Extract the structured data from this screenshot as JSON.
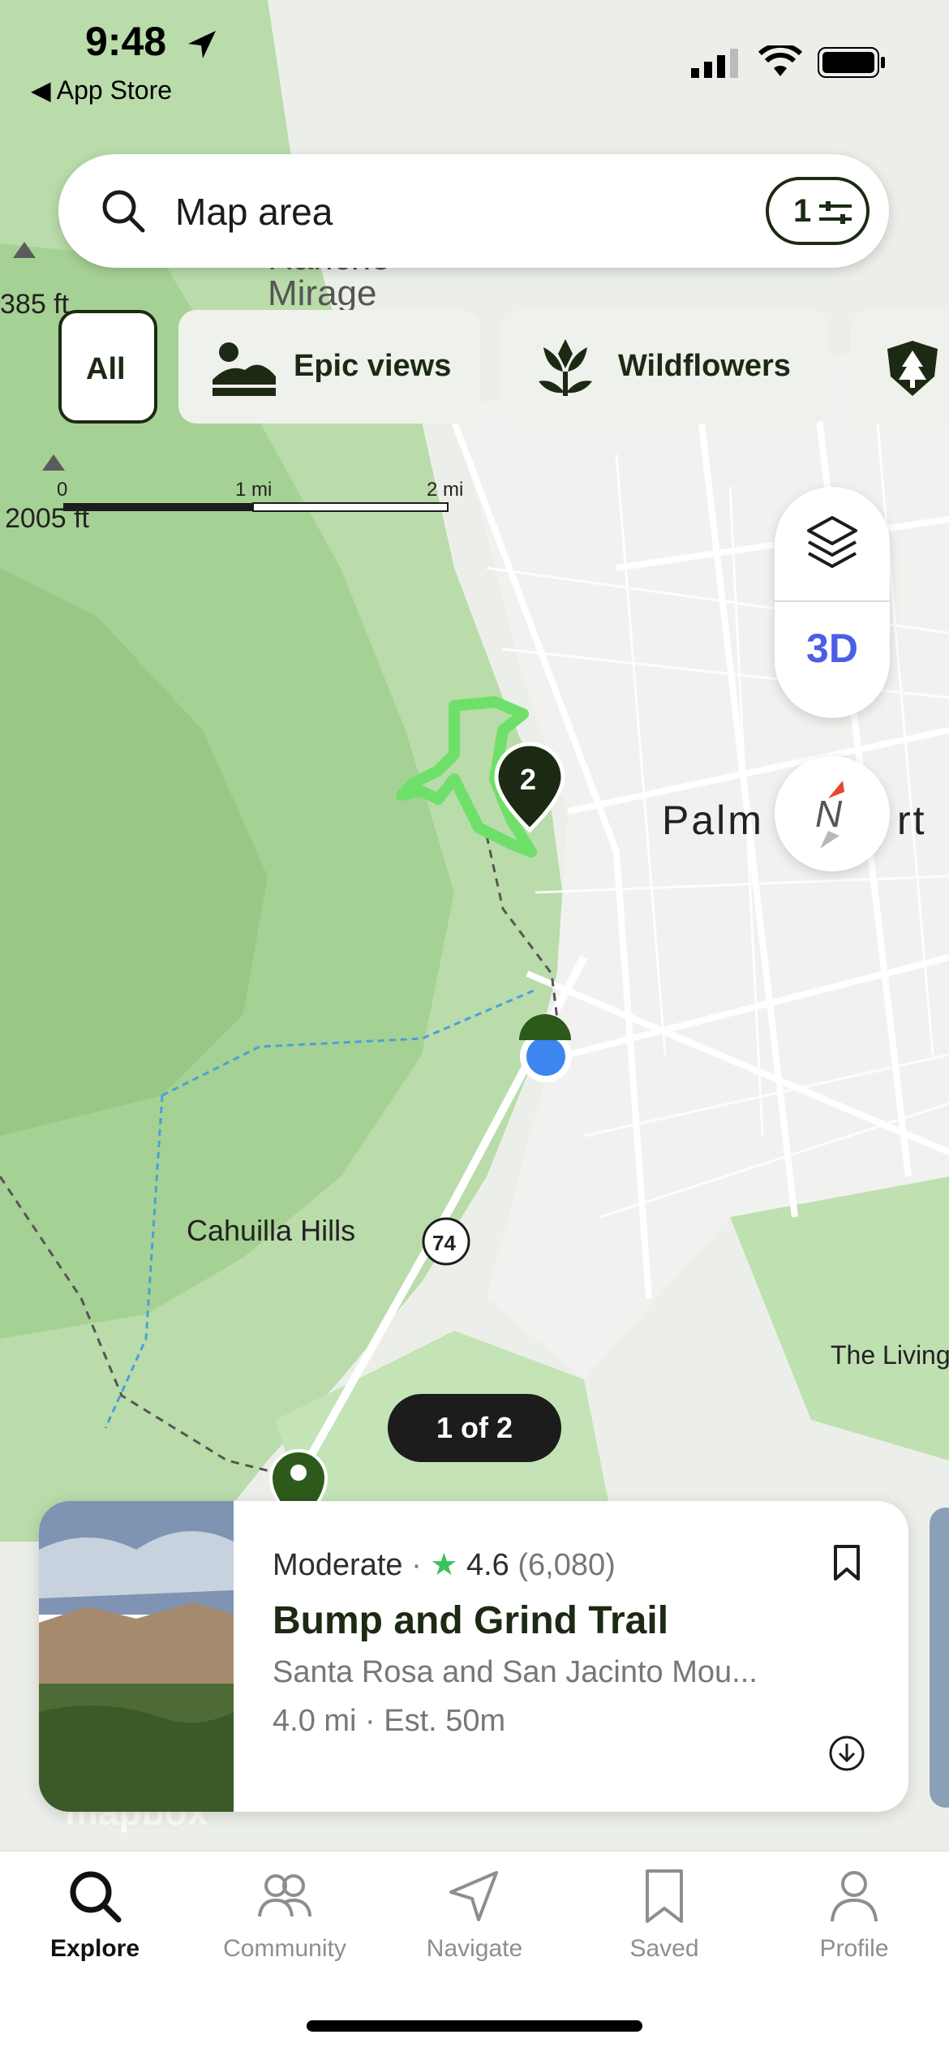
{
  "status_bar": {
    "time": "9:48",
    "back_app": "App Store"
  },
  "search": {
    "placeholder": "Map area",
    "filter_count": "1"
  },
  "chips": [
    {
      "label": "All"
    },
    {
      "label": "Epic views"
    },
    {
      "label": "Wildflowers"
    }
  ],
  "map": {
    "elevation_1": "385 ft",
    "elevation_2": "2005 ft",
    "scale": [
      "0",
      "1 mi",
      "2 mi"
    ],
    "place_rancho": "Rancho Mirage",
    "place_palm": "Palm",
    "place_palm_suffix": "rt",
    "place_cahuilla": "Cahuilla Hills",
    "place_living": "The Living",
    "route_number": "74",
    "cluster_count": "2",
    "attribution": "mapbox"
  },
  "controls": {
    "three_d_label": "3D",
    "compass_label": "N"
  },
  "pager": {
    "text": "1 of 2"
  },
  "trail_card": {
    "difficulty": "Moderate",
    "rating": "4.6",
    "reviews": "(6,080)",
    "name": "Bump and Grind Trail",
    "park": "Santa Rosa and San Jacinto Mou...",
    "length": "4.0 mi",
    "est_time": "Est. 50m"
  },
  "tabs": [
    {
      "label": "Explore",
      "icon": "search-icon",
      "active": true
    },
    {
      "label": "Community",
      "icon": "people-icon",
      "active": false
    },
    {
      "label": "Navigate",
      "icon": "navigate-arrow-icon",
      "active": false
    },
    {
      "label": "Saved",
      "icon": "bookmark-icon",
      "active": false
    },
    {
      "label": "Profile",
      "icon": "person-icon",
      "active": false
    }
  ],
  "colors": {
    "brand_dark": "#1c2a14",
    "accent_blue": "#4a5ee8",
    "trail_green": "#6ee06a",
    "star_green": "#3cc25a"
  }
}
